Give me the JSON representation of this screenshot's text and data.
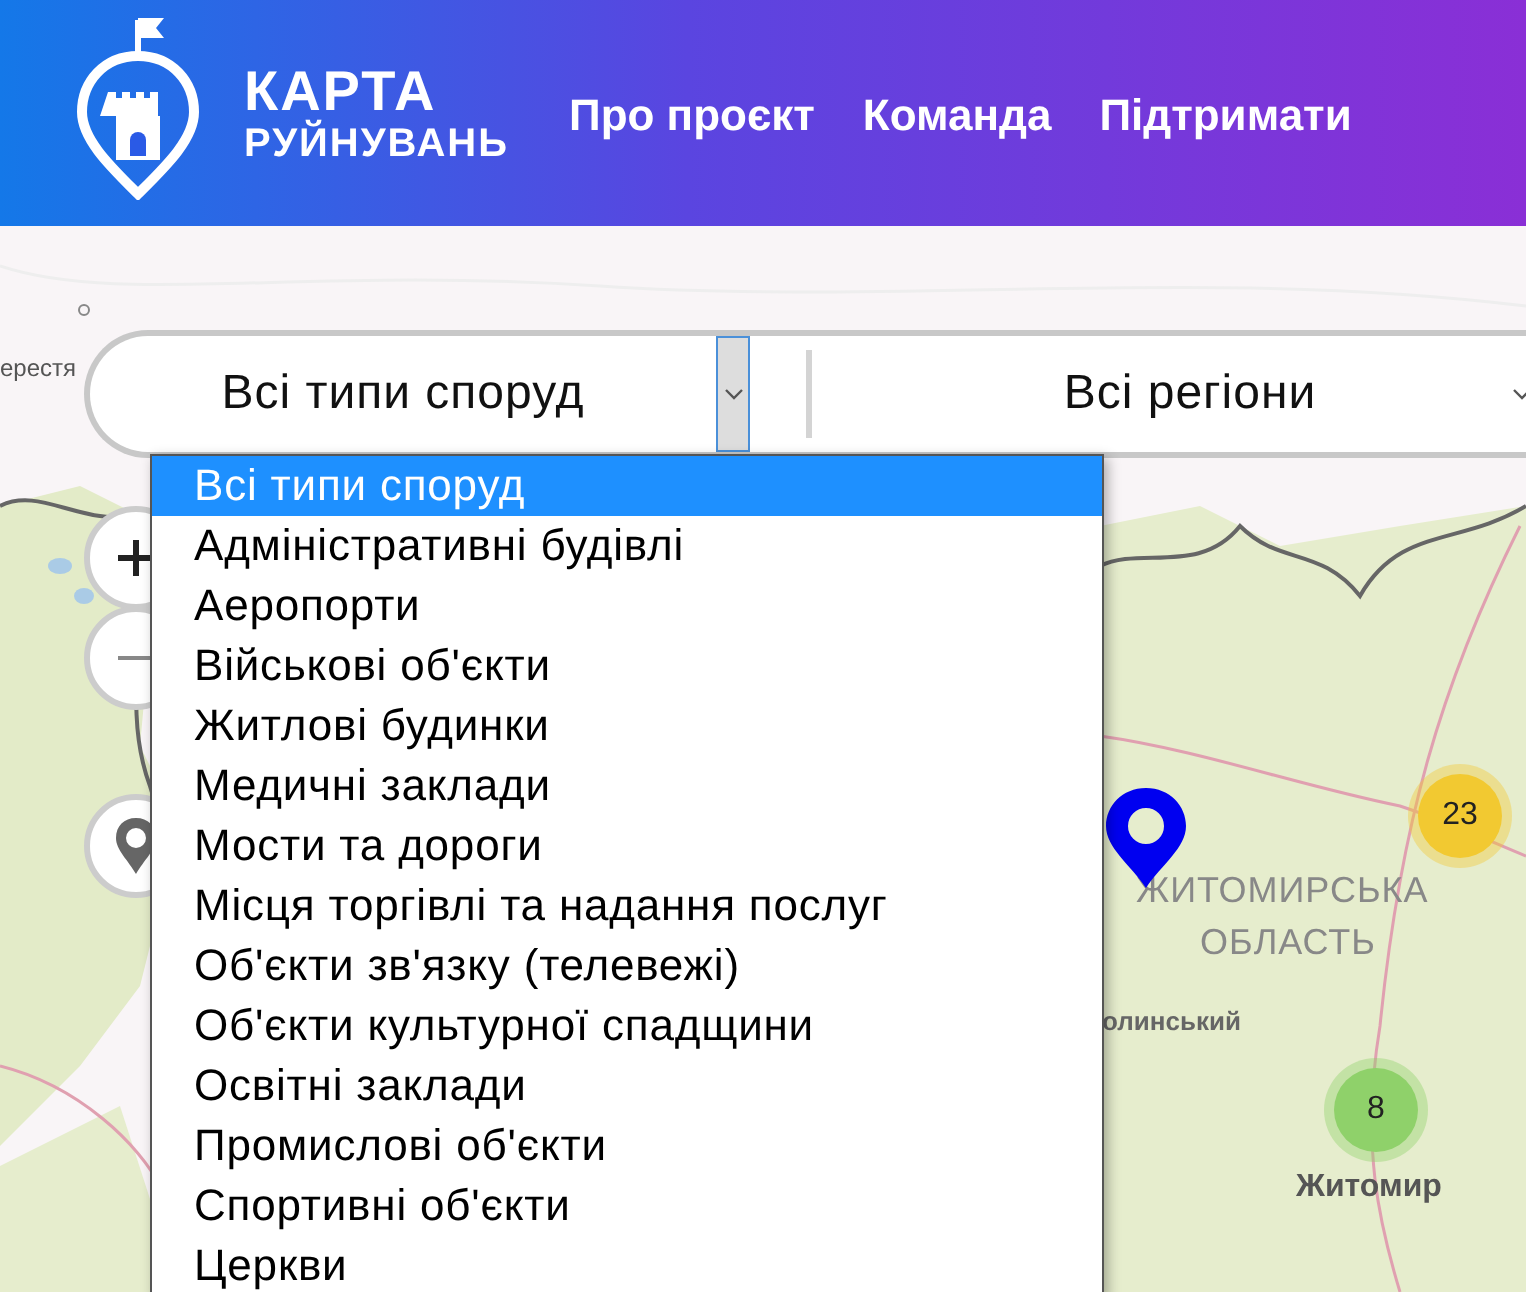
{
  "header": {
    "logo": {
      "line1": "КАРТА",
      "line2": "РУЙНУВАНЬ"
    },
    "nav": [
      "Про проєкт",
      "Команда",
      "Підтримати"
    ]
  },
  "filters": [
    {
      "value": "Всі типи споруд",
      "open": true
    },
    {
      "value": "Всі регіони",
      "open": false
    }
  ],
  "dropdown": {
    "options": [
      {
        "label": "Всі типи споруд",
        "selected": true
      },
      {
        "label": "Адміністративні будівлі",
        "selected": false
      },
      {
        "label": "Аеропорти",
        "selected": false
      },
      {
        "label": "Військові об'єкти",
        "selected": false
      },
      {
        "label": "Житлові будинки",
        "selected": false
      },
      {
        "label": "Медичні заклади",
        "selected": false
      },
      {
        "label": "Мости та дороги",
        "selected": false
      },
      {
        "label": "Місця торгівлі та надання послуг",
        "selected": false
      },
      {
        "label": "Об'єкти зв'язку (телевежі)",
        "selected": false
      },
      {
        "label": "Об'єкти культурної спадщини",
        "selected": false
      },
      {
        "label": "Освітні заклади",
        "selected": false
      },
      {
        "label": "Промислові об'єкти",
        "selected": false
      },
      {
        "label": "Спортивні об'єкти",
        "selected": false
      },
      {
        "label": "Церкви",
        "selected": false
      }
    ]
  },
  "map": {
    "labels": [
      {
        "kind": "town",
        "text": "ерестя"
      },
      {
        "kind": "region",
        "text": "ЖИТОМИРСЬКА"
      },
      {
        "kind": "region",
        "text": "ОБЛАСТЬ"
      },
      {
        "kind": "district",
        "text": "олинський"
      },
      {
        "kind": "city",
        "text": "Житомир"
      }
    ],
    "clusters": [
      {
        "count": "23",
        "color": "#f2c931"
      },
      {
        "count": "8",
        "color": "#8fd16a"
      }
    ]
  }
}
